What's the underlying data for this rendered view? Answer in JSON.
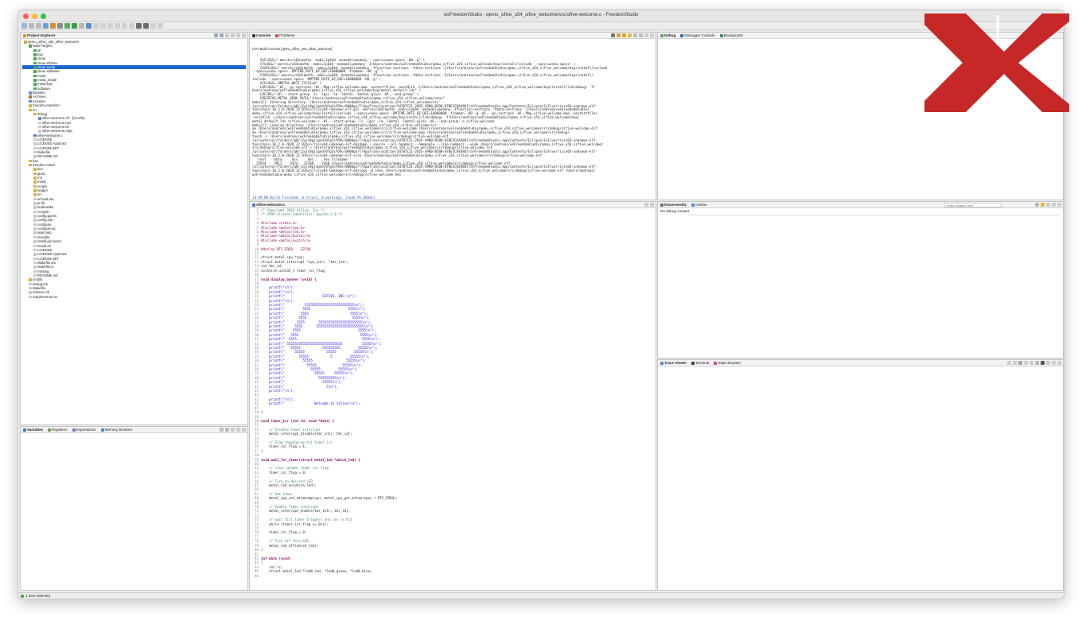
{
  "window": {
    "title": "wsFreedomStudio - qemu_sifive_u54_sifive_welcome/src/sifive-welcome.c - FreedomStudio"
  },
  "project_explorer": {
    "tab": "Project Explorer",
    "items": [
      {
        "label": "qemu_sifive_u54_sifive_welcome",
        "indent": 0,
        "icon": "project-icon"
      },
      {
        "label": "Build Targets",
        "indent": 1,
        "icon": "target-icon"
      },
      {
        "label": "all",
        "indent": 2,
        "icon": "target-icon"
      },
      {
        "label": "bsp",
        "indent": 2,
        "icon": "target-icon"
      },
      {
        "label": "clean",
        "indent": 2,
        "icon": "target-icon"
      },
      {
        "label": "clean-elf2hex",
        "indent": 2,
        "icon": "target-icon"
      },
      {
        "label": "clean-metal",
        "indent": 2,
        "icon": "target-icon",
        "selected": true
      },
      {
        "label": "clean-software",
        "indent": 2,
        "icon": "target-icon"
      },
      {
        "label": "metal",
        "indent": 2,
        "icon": "target-icon"
      },
      {
        "label": "metal_install",
        "indent": 2,
        "icon": "target-icon"
      },
      {
        "label": "metal-bsp",
        "indent": 2,
        "icon": "target-icon"
      },
      {
        "label": "software",
        "indent": 2,
        "icon": "target-icon"
      },
      {
        "label": "Binaries",
        "indent": 1,
        "icon": "binary-icon"
      },
      {
        "label": "Archives",
        "indent": 1,
        "icon": "archive-icon"
      },
      {
        "label": "Includes",
        "indent": 1,
        "icon": "include-icon"
      },
      {
        "label": "freedom-metal/src",
        "indent": 1,
        "icon": "folder-icon"
      },
      {
        "label": "src",
        "indent": 1,
        "icon": "folder-icon"
      },
      {
        "label": "debug",
        "indent": 2,
        "icon": "folder-icon"
      },
      {
        "label": "sifive-welcome.elf - [riscv/le]",
        "indent": 3,
        "icon": "binary-icon"
      },
      {
        "label": "sifive-welcome.hex",
        "indent": 3,
        "icon": "file-icon"
      },
      {
        "label": "sifive-welcome.lst",
        "indent": 3,
        "icon": "file-icon"
      },
      {
        "label": "sifive-welcome.map",
        "indent": 3,
        "icon": "file-icon"
      },
      {
        "label": "sifive-welcome.c",
        "indent": 2,
        "icon": "c-file-icon"
      },
      {
        "label": "LICENSE",
        "indent": 2,
        "icon": "file-icon"
      },
      {
        "label": "LICENSE.Apache2",
        "indent": 2,
        "icon": "file-icon"
      },
      {
        "label": "LICENSE.MIT",
        "indent": 2,
        "icon": "file-icon"
      },
      {
        "label": "Makefile",
        "indent": 2,
        "icon": "file-icon"
      },
      {
        "label": "README.md",
        "indent": 2,
        "icon": "file-icon"
      },
      {
        "label": "bsp",
        "indent": 1,
        "icon": "folder-icon"
      },
      {
        "label": "freedom-metal",
        "indent": 1,
        "icon": "folder-icon"
      },
      {
        "label": "doc",
        "indent": 2,
        "icon": "folder-icon"
      },
      {
        "label": "gloss",
        "indent": 2,
        "icon": "folder-icon"
      },
      {
        "label": "m4",
        "indent": 2,
        "icon": "folder-icon"
      },
      {
        "label": "metal",
        "indent": 2,
        "icon": "folder-icon"
      },
      {
        "label": "scripts",
        "indent": 2,
        "icon": "folder-icon"
      },
      {
        "label": "segger",
        "indent": 2,
        "icon": "folder-icon"
      },
      {
        "label": "src",
        "indent": 2,
        "icon": "folder-icon"
      },
      {
        "label": "aclocal.m4",
        "indent": 2,
        "icon": "file-icon"
      },
      {
        "label": "ar-lib",
        "indent": 2,
        "icon": "file-icon"
      },
      {
        "label": "build.wake",
        "indent": 2,
        "icon": "file-icon"
      },
      {
        "label": "compile",
        "indent": 2,
        "icon": "file-icon"
      },
      {
        "label": "config.guess",
        "indent": 2,
        "icon": "file-icon"
      },
      {
        "label": "config.sub",
        "indent": 2,
        "icon": "file-icon"
      },
      {
        "label": "configure",
        "indent": 2,
        "icon": "file-icon"
      },
      {
        "label": "configure.ac",
        "indent": 2,
        "icon": "file-icon"
      },
      {
        "label": "depcomp",
        "indent": 2,
        "icon": "file-icon"
      },
      {
        "label": "Doxyfile",
        "indent": 2,
        "icon": "file-icon"
      },
      {
        "label": "install-git-hooks",
        "indent": 2,
        "icon": "file-icon"
      },
      {
        "label": "install-sh",
        "indent": 2,
        "icon": "file-icon"
      },
      {
        "label": "LICENSE",
        "indent": 2,
        "icon": "file-icon"
      },
      {
        "label": "LICENSE.Apache2",
        "indent": 2,
        "icon": "file-icon"
      },
      {
        "label": "LICENSE.MIT",
        "indent": 2,
        "icon": "file-icon"
      },
      {
        "label": "Makefile.am",
        "indent": 2,
        "icon": "file-icon"
      },
      {
        "label": "Makefile.in",
        "indent": 2,
        "icon": "file-icon"
      },
      {
        "label": "missing",
        "indent": 2,
        "icon": "file-icon"
      },
      {
        "label": "README.md",
        "indent": 2,
        "icon": "file-icon"
      },
      {
        "label": "scripts",
        "indent": 1,
        "icon": "folder-icon"
      },
      {
        "label": "debug.mk",
        "indent": 1,
        "icon": "file-icon"
      },
      {
        "label": "Makefile",
        "indent": 1,
        "icon": "file-icon"
      },
      {
        "label": "release.mk",
        "indent": 1,
        "icon": "file-icon"
      },
      {
        "label": "requirements.txt",
        "indent": 1,
        "icon": "file-icon"
      }
    ]
  },
  "variables_panel": {
    "tabs": [
      "Variables",
      "Registers",
      "Expressions",
      "Memory Browser"
    ]
  },
  "console": {
    "tabs": [
      "Console",
      "Problems"
    ],
    "header": "CDT Build Console [qemu_sifive_u54_sifive_welcome]",
    "lines": [
      "    ASFLAGS=\"-march=rv64imafdc -mabi=lp64d -mcmodel=medany --specs=nano.specs -O0 -g\" \\",
      "    CFLAGS=\"-march=rv64imafdc -mabi=lp64d -mcmodel=medany -I/Users/andreas/wsFreedomStudio/qemu_sifive_u54_sifive_welcome/bsp/install/include --specs=nano.specs\" \\",
      "    CXXFLAGS=\"-march=rv64imafdc -mabi=lp64d -mcmodel=medany -ffunction-sections -fdata-sections -I/Users/andreas/wsFreedomStudio/qemu_sifive_u54_sifive_welcome/bsp/install/include",
      "--specs=nano.specs -DMTIME_RATE_HZ_DEF=10000000 -fcommon -O0 -g\" \\",
      "    CXXFLAGS=\"-march=rv64imafdc -mabi=lp64d -mcmodel=medany -ffunction-sections -fdata-sections -I/Users/andreas/wsFreedomStudio/qemu_sifive_u54_sifive_welcome/bsp/install/",
      "include --specs=nano.specs -DMTIME_RATE_HZ_DEF=10000000 -O0 -g\" \\",
      "    XCFLAGS=-DMETAL_WAIT_CYCLE=0\" \\",
      "    LDFLAGS=\"-Wl,--gc-sections -Wl,-Map,sifive-welcome.map -nostartfiles -nostdlib -L/Users/andreas/wsFreedomStudio/qemu_sifive_u54_sifive_welcome/bsp/install/lib/debug/ -T/",
      "Users/andreas/wsFreedomStudio/qemu_sifive_u54_sifive_welcome/bsp/metal.default.lds\" \\",
      "    LDLIBS=\"-Wl,--start-group -lc -lgcc -lm -lmetal -lmetal-gloss -Wl,--end-group\" \\",
      "    FREERTOS_METAL_VENV_PATH=\"/Users/andreas/wsFreedomStudio/qemu_sifive_u54_sifive_welcome/venv\"",
      "make[1]: Entering directory '/Users/andreas/wsFreedomStudio/qemu_sifive_u54_sifive_welcome/src'",
      "/private/var/folders/g8/j2yjs8gj1gndr0fg3sf69v/0000gn/T/AppTranslocation/347B7C21-282E-49B0-BCB0-07BE3C844867/d/FreedomStudio.app/Contents/Eclipse/SiFive/riscv64-unknown-elf-",
      "toolchain-10.2.0-2020.12.8/bin/riscv64-unknown-elf-gcc -march=rv64imafdc -mabi=lp64d -mcmodel=medany -ffunction-sections -fdata-sections -I/Users/andreas/wsFreedomStudio/",
      "qemu_sifive_u54_sifive_welcome/bsp/install/include --specs=nano.specs -DMTIME_RATE_HZ_DEF=10000000 -fcommon -O0 -g -Wl,--gc-sections -Wl,-Map,sifive-welcome.map -nostartfiles",
      "-nostdlib -L/Users/andreas/wsFreedomStudio/qemu_sifive_u54_sifive_welcome/bsp/install/lib/debug/ -T/Users/andreas/wsFreedomStudio/qemu_sifive_u54_sifive_welcome/bsp/",
      "metal.default.lds sifive-welcome.c -Wl,--start-group -lc -lgcc -lm -lmetal -lmetal-gloss -Wl,--end-group -o sifive-welcome",
      "make[1]: Leaving directory '/Users/andreas/wsFreedomStudio/qemu_sifive_u54_sifive_welcome/src'",
      "mv /Users/andreas/wsFreedomStudio/qemu_sifive_u54_sifive_welcome/src/sifive-welcome /Users/andreas/wsFreedomStudio/qemu_sifive_u54_sifive_welcome/src/debug/sifive-welcome.elf",
      "mv /Users/andreas/wsFreedomStudio/qemu_sifive_u54_sifive_welcome/src/sifive-welcome.map /Users/andreas/wsFreedomStudio/qemu_sifive_u54_sifive_welcome/src/debug/",
      "touch -c /Users/andreas/wsFreedomStudio/qemu_sifive_u54_sifive_welcome/src/debug/sifive-welcome.elf",
      "/private/var/folders/g8/j2yjs8gj1gndr0fg3sf69v/0000gn/T/AppTranslocation/347B7C21-282E-49B0-BCB0-07BE3C844867/d/FreedomStudio.app/Contents/Eclipse/SiFive/riscv64-unknown-elf-",
      "toolchain-10.2.0-2020.12.8/bin/riscv64-unknown-elf-objdump --source --all-headers --demangle --line-numbers --wide /Users/andreas/wsFreedomStudio/qemu_sifive_u54_sifive_welcome/",
      "src/debug/sifive-welcome.elf > /Users/andreas/wsFreedomStudio/qemu_sifive_u54_sifive_welcome/src/debug/sifive-welcome.lst",
      "/private/var/folders/g8/j2yjs8gj1gndr0fg3sf69v/0000gn/T/AppTranslocation/347B7C21-282E-49B0-BCB0-07BE3C844867/d/FreedomStudio.app/Contents/Eclipse/SiFive/riscv64-unknown-elf-",
      "toolchain-10.2.0-2020.12.8/bin/riscv64-unknown-elf-size /Users/andreas/wsFreedomStudio/qemu_sifive_u54_sifive_welcome/src/debug/sifive-welcome.elf",
      "   text    data     bss     dec     hex filename",
      "  25024    3912    3424   32360    7e68 /Users/andreas/wsFreedomStudio/qemu_sifive_u54_sifive_welcome/src/debug/sifive-welcome.elf",
      "/private/var/folders/g8/j2yjs8gj1gndr0fg3sf69v/0000gn/T/AppTranslocation/347B7C21-282E-49B0-BCB0-07BE3C844867/d/FreedomStudio.app/Contents/Eclipse/SiFive/riscv64-unknown-elf-",
      "toolchain-10.2.0-2020.12.8/bin/riscv64-unknown-elf-objcopy -O ihex /Users/andreas/wsFreedomStudio/qemu_sifive_u54_sifive_welcome/src/debug/sifive-welcome.elf /Users/andreas/",
      "wsFreedomStudio/qemu_sifive_u54_sifive_welcome/src/debug/sifive-welcome.hex"
    ],
    "finished": "14:49:00 Build Finished. 0 errors, 0 warnings. (took 9s.602ms)"
  },
  "editor": {
    "tab": "sifive-welcome.c",
    "lines": [
      {
        "n": "1",
        "t": "/* Copyright 2019 SiFive, Inc */",
        "c": "cm"
      },
      {
        "n": "2",
        "t": "/* SPDX-License-Identifier: Apache-2.0 */",
        "c": "cm"
      },
      {
        "n": "3",
        "t": "",
        "c": ""
      },
      {
        "n": "4",
        "t": "#include <stdio.h>",
        "c": "pp"
      },
      {
        "n": "5",
        "t": "#include <metal/cpu.h>",
        "c": "pp"
      },
      {
        "n": "6",
        "t": "#include <metal/led.h>",
        "c": "pp"
      },
      {
        "n": "7",
        "t": "#include <metal/button.h>",
        "c": "pp"
      },
      {
        "n": "8",
        "t": "#include <metal/switch.h>",
        "c": "pp"
      },
      {
        "n": "9",
        "t": "",
        "c": ""
      },
      {
        "n": "10",
        "t": "#define RTC_FREQ    32768",
        "c": "pp"
      },
      {
        "n": "11",
        "t": "",
        "c": ""
      },
      {
        "n": "12",
        "t": "struct metal_cpu *cpu;",
        "c": ""
      },
      {
        "n": "13",
        "t": "struct metal_interrupt *cpu_intr, *tmr_intr;",
        "c": ""
      },
      {
        "n": "14",
        "t": "int tmr_id;",
        "c": ""
      },
      {
        "n": "15",
        "t": "volatile uint32_t timer_isr_flag;",
        "c": ""
      },
      {
        "n": "16",
        "t": "",
        "c": ""
      },
      {
        "n": "17",
        "t": "void display_banner (void) {",
        "c": "kw"
      },
      {
        "n": "18",
        "t": "",
        "c": ""
      },
      {
        "n": "19",
        "t": "    printf(\"\\n\");",
        "c": "st"
      },
      {
        "n": "20",
        "t": "    printf(\"\\n\");",
        "c": "st"
      },
      {
        "n": "21",
        "t": "    printf(\"                   SIFIVE, INC.\\n\");",
        "c": "st"
      },
      {
        "n": "22",
        "t": "    printf(\"\\n\");",
        "c": "st"
      },
      {
        "n": "23",
        "t": "    printf(\"          5555555555555555555555555\\n\");",
        "c": "st"
      },
      {
        "n": "24",
        "t": "    printf(\"         5555                   5555\\n\");",
        "c": "st"
      },
      {
        "n": "25",
        "t": "    printf(\"        5555                     5555\\n\");",
        "c": "st"
      },
      {
        "n": "26",
        "t": "    printf(\"       5555                       5555\\n\");",
        "c": "st"
      },
      {
        "n": "27",
        "t": "    printf(\"      5555       5555555555555555555555\\n\");",
        "c": "st"
      },
      {
        "n": "28",
        "t": "    printf(\"     5555       555555555555555555555555\\n\");",
        "c": "st"
      },
      {
        "n": "29",
        "t": "    printf(\"    5555                             5555\\n\");",
        "c": "st"
      },
      {
        "n": "30",
        "t": "    printf(\"   5555                               5555\\n\");",
        "c": "st"
      },
      {
        "n": "31",
        "t": "    printf(\"  5555                                 5555\\n\");",
        "c": "st"
      },
      {
        "n": "32",
        "t": "    printf(\" 5555555555555555555555555555          55555\\n\");",
        "c": "st"
      },
      {
        "n": "33",
        "t": "    printf(\"   55555           555555555         55555\\n\");",
        "c": "st"
      },
      {
        "n": "34",
        "t": "    printf(\"     55555           55555         55555\\n\");",
        "c": "st"
      },
      {
        "n": "35",
        "t": "    printf(\"       55555           5         55555\\n\");",
        "c": "st"
      },
      {
        "n": "36",
        "t": "    printf(\"         55555                 55555\\n\");",
        "c": "st"
      },
      {
        "n": "37",
        "t": "    printf(\"           55555             55555\\n\");",
        "c": "st"
      },
      {
        "n": "38",
        "t": "    printf(\"             55555         55555\\n\");",
        "c": "st"
      },
      {
        "n": "39",
        "t": "    printf(\"               55555     55555\\n\");",
        "c": "st"
      },
      {
        "n": "40",
        "t": "    printf(\"                 555555555\\n\");",
        "c": "st"
      },
      {
        "n": "41",
        "t": "    printf(\"                   55555\\n\");",
        "c": "st"
      },
      {
        "n": "42",
        "t": "    printf(\"                     5\\n\");",
        "c": "st"
      },
      {
        "n": "43",
        "t": "    printf(\"\\n\");",
        "c": "st"
      },
      {
        "n": "44",
        "t": "",
        "c": ""
      },
      {
        "n": "45",
        "t": "    printf(\"\\n\");",
        "c": "st"
      },
      {
        "n": "46",
        "t": "    printf(\"               Welcome to SiFive!\\n\");",
        "c": "st"
      },
      {
        "n": "47",
        "t": "",
        "c": ""
      },
      {
        "n": "48",
        "t": "}",
        "c": ""
      },
      {
        "n": "49",
        "t": "",
        "c": ""
      },
      {
        "n": "50",
        "t": "void timer_isr (int id, void *data) {",
        "c": "kw"
      },
      {
        "n": "51",
        "t": "",
        "c": ""
      },
      {
        "n": "52",
        "t": "    // Disable Timer interrupt",
        "c": "cm"
      },
      {
        "n": "53",
        "t": "    metal_interrupt_disable(tmr_intr, tmr_id);",
        "c": ""
      },
      {
        "n": "54",
        "t": "",
        "c": ""
      },
      {
        "n": "55",
        "t": "    // Flag showing we hit timer isr",
        "c": "cm"
      },
      {
        "n": "56",
        "t": "    timer_isr_flag = 1;",
        "c": ""
      },
      {
        "n": "57",
        "t": "}",
        "c": ""
      },
      {
        "n": "58",
        "t": "",
        "c": ""
      },
      {
        "n": "59",
        "t": "void wait_for_timer(struct metal_led *which_led) {",
        "c": "kw"
      },
      {
        "n": "60",
        "t": "",
        "c": ""
      },
      {
        "n": "61",
        "t": "    // clear global timer isr flag",
        "c": "cm"
      },
      {
        "n": "62",
        "t": "    timer_isr_flag = 0;",
        "c": ""
      },
      {
        "n": "63",
        "t": "",
        "c": ""
      },
      {
        "n": "64",
        "t": "    // Turn on desired LED",
        "c": "cm"
      },
      {
        "n": "65",
        "t": "    metal_led_on(which_led);",
        "c": ""
      },
      {
        "n": "66",
        "t": "",
        "c": ""
      },
      {
        "n": "67",
        "t": "    // Set timer",
        "c": "cm"
      },
      {
        "n": "68",
        "t": "    metal_cpu_set_mtimecmp(cpu, metal_cpu_get_mtime(cpu) + RTC_FREQ);",
        "c": ""
      },
      {
        "n": "69",
        "t": "",
        "c": ""
      },
      {
        "n": "70",
        "t": "    // Enable Timer interrupt",
        "c": "cm"
      },
      {
        "n": "71",
        "t": "    metal_interrupt_enable(tmr_intr, tmr_id);",
        "c": ""
      },
      {
        "n": "72",
        "t": "",
        "c": ""
      },
      {
        "n": "73",
        "t": "    // wait till timer triggers and isr is hit",
        "c": "cm"
      },
      {
        "n": "74",
        "t": "    while (timer_isr_flag == 0){};",
        "c": ""
      },
      {
        "n": "75",
        "t": "",
        "c": ""
      },
      {
        "n": "76",
        "t": "    timer_isr_flag = 0;",
        "c": ""
      },
      {
        "n": "77",
        "t": "",
        "c": ""
      },
      {
        "n": "78",
        "t": "    // Turn off this LED",
        "c": "cm"
      },
      {
        "n": "79",
        "t": "    metal_led_off(which_led);",
        "c": ""
      },
      {
        "n": "80",
        "t": "}",
        "c": ""
      },
      {
        "n": "81",
        "t": "",
        "c": ""
      },
      {
        "n": "82",
        "t": "int main (void)",
        "c": "kw"
      },
      {
        "n": "83",
        "t": "{",
        "c": ""
      },
      {
        "n": "84",
        "t": "    int rc;",
        "c": ""
      },
      {
        "n": "85",
        "t": "    struct metal_led *led0_red, *led0_green, *led0_blue;",
        "c": ""
      },
      {
        "n": "86",
        "t": "",
        "c": ""
      }
    ]
  },
  "debug_panel": {
    "tabs": [
      "Debug",
      "Debugger Console",
      "Breakpoints"
    ]
  },
  "disassembly_panel": {
    "tabs": [
      "Disassembly",
      "Outline"
    ],
    "placeholder": "Enter location here",
    "content": "No debug context"
  },
  "trace_panel": {
    "tabs": [
      "Trace Viewer",
      "Terminal",
      "State Browser"
    ]
  },
  "status_bar": {
    "text": "1 item selected"
  },
  "colors": {
    "selection": "#1e66d0",
    "logo": "#c62828"
  }
}
